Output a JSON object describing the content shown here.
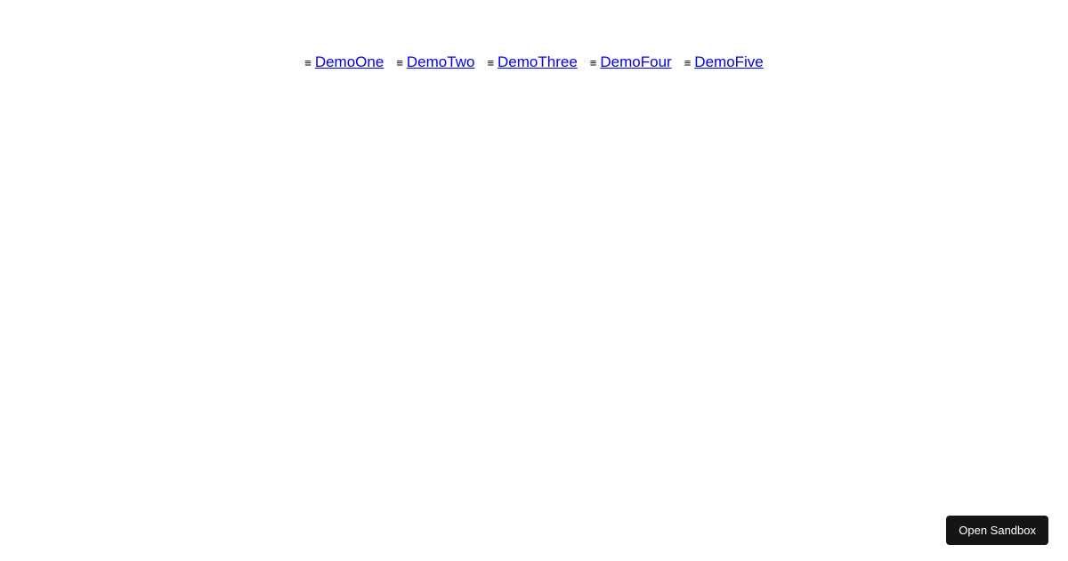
{
  "nav": {
    "items": [
      {
        "label": "DemoOne"
      },
      {
        "label": "DemoTwo"
      },
      {
        "label": "DemoThree"
      },
      {
        "label": "DemoFour"
      },
      {
        "label": "DemoFive"
      }
    ]
  },
  "actions": {
    "open_sandbox": "Open Sandbox"
  },
  "icons": {
    "drag_handle": "≡"
  }
}
